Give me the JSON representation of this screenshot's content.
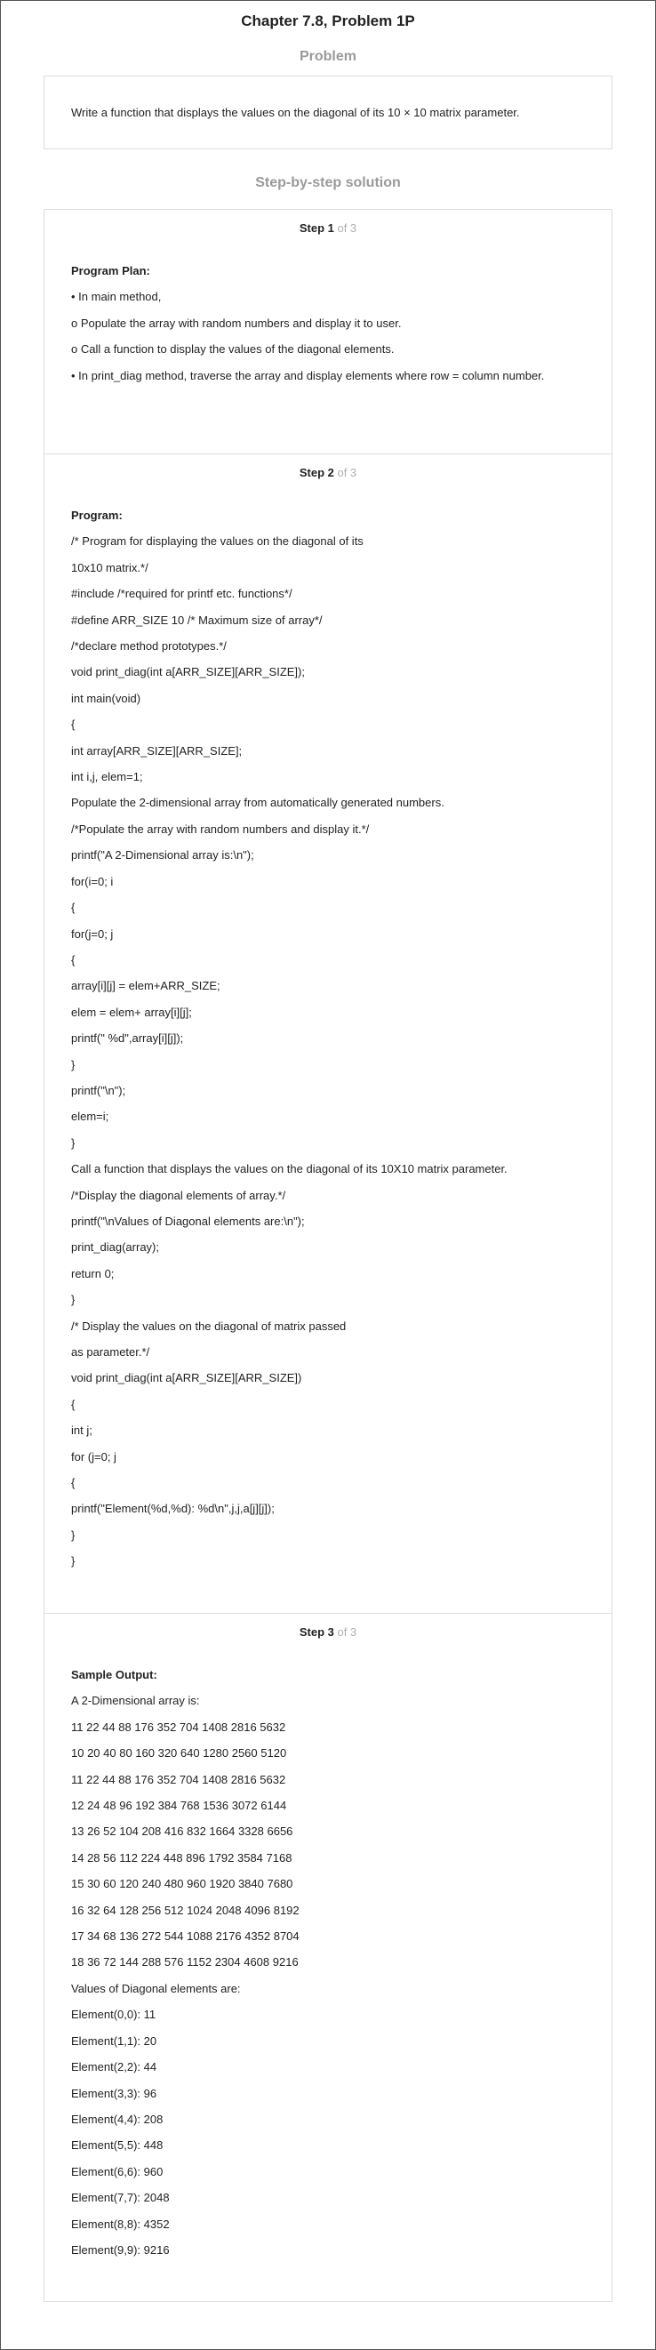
{
  "page": {
    "title": "Chapter 7.8, Problem 1P",
    "problem_heading": "Problem",
    "problem_text": "Write a function that displays the values on the diagonal of its 10 × 10 matrix parameter.",
    "solution_heading": "Step-by-step solution"
  },
  "steps": [
    {
      "label": "Step 1",
      "of": " of 3",
      "lines": [
        {
          "text": "Program Plan:",
          "bold": true
        },
        {
          "text": "• In main method,"
        },
        {
          "text": "o Populate the array with random numbers and display it to user."
        },
        {
          "text": "o Call a function to display the values of the diagonal elements."
        },
        {
          "text": "• In print_diag method, traverse the array and display elements where row = column number.",
          "multi": true
        }
      ]
    },
    {
      "label": "Step 2",
      "of": " of 3",
      "lines": [
        {
          "text": "Program:",
          "bold": true
        },
        {
          "text": "/* Program for displaying the values on the diagonal of its"
        },
        {
          "text": "10x10 matrix.*/"
        },
        {
          "text": "#include /*required for printf etc. functions*/"
        },
        {
          "text": "#define ARR_SIZE 10 /* Maximum size of array*/"
        },
        {
          "text": "/*declare method prototypes.*/"
        },
        {
          "text": "void print_diag(int a[ARR_SIZE][ARR_SIZE]);"
        },
        {
          "text": "int main(void)"
        },
        {
          "text": "{"
        },
        {
          "text": "int array[ARR_SIZE][ARR_SIZE];"
        },
        {
          "text": "int i,j, elem=1;"
        },
        {
          "text": "Populate the 2-dimensional array from automatically generated numbers."
        },
        {
          "text": "/*Populate the array with random numbers and display it.*/"
        },
        {
          "text": "printf(\"A 2-Dimensional array is:\\n\");"
        },
        {
          "text": "for(i=0; i"
        },
        {
          "text": "{"
        },
        {
          "text": "for(j=0; j"
        },
        {
          "text": "{"
        },
        {
          "text": "array[i][j] = elem+ARR_SIZE;"
        },
        {
          "text": "elem = elem+ array[i][j];"
        },
        {
          "text": "printf(\" %d\",array[i][j]);"
        },
        {
          "text": "}"
        },
        {
          "text": "printf(\"\\n\");"
        },
        {
          "text": "elem=i;"
        },
        {
          "text": "}"
        },
        {
          "text": "Call a function that displays the values on the diagonal of its 10X10 matrix parameter."
        },
        {
          "text": "/*Display the diagonal elements of array.*/"
        },
        {
          "text": "printf(\"\\nValues of Diagonal elements are:\\n\");"
        },
        {
          "text": "print_diag(array);"
        },
        {
          "text": "return 0;"
        },
        {
          "text": "}"
        },
        {
          "text": "/* Display the values on the diagonal of matrix passed"
        },
        {
          "text": "as parameter.*/"
        },
        {
          "text": "void print_diag(int a[ARR_SIZE][ARR_SIZE])"
        },
        {
          "text": "{"
        },
        {
          "text": "int j;"
        },
        {
          "text": "for (j=0; j"
        },
        {
          "text": "{"
        },
        {
          "text": "printf(\"Element(%d,%d): %d\\n\",j,j,a[j][j]);"
        },
        {
          "text": "}"
        },
        {
          "text": "}"
        }
      ]
    },
    {
      "label": "Step 3",
      "of": " of 3",
      "lines": [
        {
          "text": "Sample Output:",
          "bold": true
        },
        {
          "text": "A 2-Dimensional array is:"
        },
        {
          "text": "11 22 44 88 176 352 704 1408 2816 5632"
        },
        {
          "text": "10 20 40 80 160 320 640 1280 2560 5120"
        },
        {
          "text": "11 22 44 88 176 352 704 1408 2816 5632"
        },
        {
          "text": "12 24 48 96 192 384 768 1536 3072 6144"
        },
        {
          "text": "13 26 52 104 208 416 832 1664 3328 6656"
        },
        {
          "text": "14 28 56 112 224 448 896 1792 3584 7168"
        },
        {
          "text": "15 30 60 120 240 480 960 1920 3840 7680"
        },
        {
          "text": "16 32 64 128 256 512 1024 2048 4096 8192"
        },
        {
          "text": "17 34 68 136 272 544 1088 2176 4352 8704"
        },
        {
          "text": "18 36 72 144 288 576 1152 2304 4608 9216"
        },
        {
          "text": "Values of Diagonal elements are:"
        },
        {
          "text": "Element(0,0): 11"
        },
        {
          "text": "Element(1,1): 20"
        },
        {
          "text": "Element(2,2): 44"
        },
        {
          "text": "Element(3,3): 96"
        },
        {
          "text": "Element(4,4): 208"
        },
        {
          "text": "Element(5,5): 448"
        },
        {
          "text": "Element(6,6): 960"
        },
        {
          "text": "Element(7,7): 2048"
        },
        {
          "text": "Element(8,8): 4352"
        },
        {
          "text": "Element(9,9): 9216"
        }
      ]
    }
  ]
}
